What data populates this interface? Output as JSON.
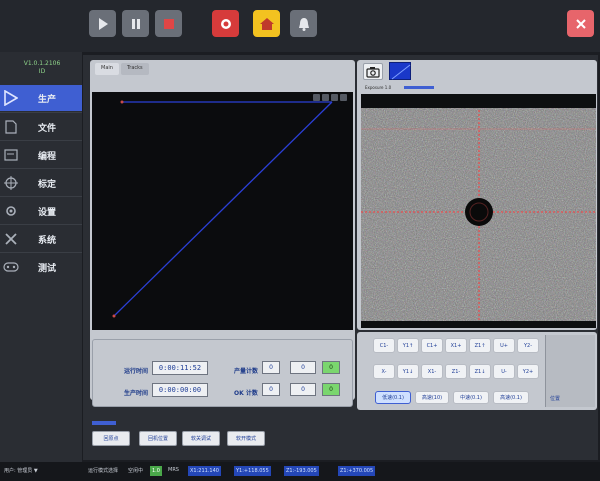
{
  "topbar": {
    "play": "play-icon",
    "pause": "pause-icon",
    "stop": "stop-icon",
    "record": "record-icon",
    "home": "home-icon",
    "bell": "bell-icon",
    "close": "close-icon",
    "colors": {
      "grey": "#6a6f78",
      "red": "#d63b3b",
      "yellow": "#f3c220",
      "close": "#e7656b"
    }
  },
  "sidebar": {
    "version_line1": "V1.0.1.2106",
    "version_line2": "ID",
    "items": [
      {
        "label": "生产",
        "icon": "play-triangle-icon",
        "active": true
      },
      {
        "label": "文件",
        "icon": "file-icon",
        "active": false
      },
      {
        "label": "编程",
        "icon": "program-icon",
        "active": false
      },
      {
        "label": "标定",
        "icon": "crosshair-icon",
        "active": false
      },
      {
        "label": "设置",
        "icon": "settings-icon",
        "active": false
      },
      {
        "label": "系统",
        "icon": "tools-icon",
        "active": false
      },
      {
        "label": "测试",
        "icon": "gamepad-icon",
        "active": false
      }
    ],
    "active_color": "#3f5fd2"
  },
  "plot_panel": {
    "tabs": [
      "Main",
      "Tracks"
    ]
  },
  "stats": {
    "run_time_label": "运行时间",
    "run_time_value": "0:00:11:52",
    "production_time_label": "生产时间",
    "production_time_value": "0:00:00:00",
    "output_label": "产量计数",
    "output_values": [
      "0",
      "0",
      "0"
    ],
    "ok_label": "OK 计数",
    "ok_values": [
      "0",
      "0",
      "0"
    ]
  },
  "camera": {
    "exposure_label": "Exposure 1.0"
  },
  "jog": {
    "rows": [
      [
        "C1-",
        "Y1↑",
        "C1+",
        "X1+",
        "Z1↑",
        "U+",
        "Y2-"
      ],
      [
        "X-",
        "Y1↓",
        "X1-",
        "Z1-",
        "Z1↓",
        "U-",
        "Y2+"
      ]
    ],
    "speeds": [
      "低速(0.1)",
      "高速(10)",
      "中速(0.1)",
      "高速(0.1)"
    ],
    "side_label": "位置"
  },
  "actions": [
    "回原点",
    "回机位置",
    "软关调试",
    "软开模式"
  ],
  "statusbar": {
    "user": "用户: 管理员 ▼",
    "mode": "运行模式选择",
    "state_label": "空闲中",
    "state_value": "1.0",
    "speed_label": "MRS",
    "coords": [
      "X1:211.140",
      "Y1:+118.055",
      "Z1:-193.005",
      "Z1:+370.005"
    ]
  }
}
